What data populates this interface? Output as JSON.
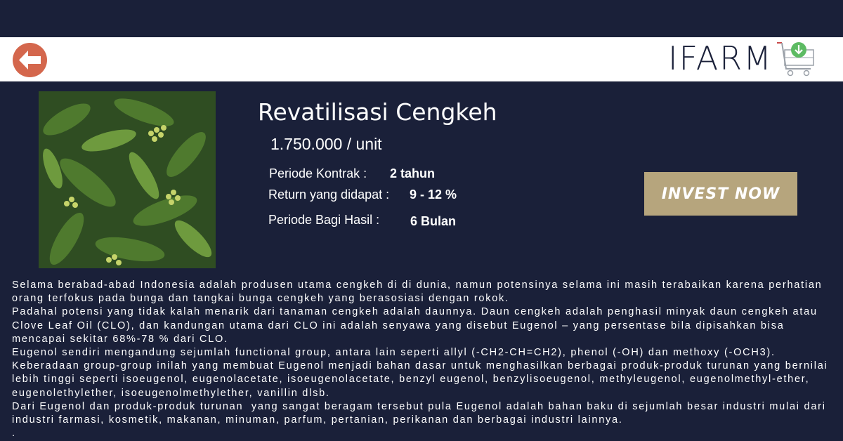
{
  "header": {
    "logo_text": "IFARM"
  },
  "product": {
    "title": "Revatilisasi Cengkeh",
    "price": "1.750.000 / unit",
    "details": [
      {
        "label": "Periode Kontrak :",
        "value": "2 tahun"
      },
      {
        "label": "Return yang didapat :",
        "value": "9 - 12 %"
      },
      {
        "label": "Periode Bagi Hasil :",
        "value": "6 Bulan"
      }
    ],
    "invest_label": "INVEST NOW"
  },
  "description": [
    "Selama berabad-abad Indonesia adalah produsen utama cengkeh di di dunia, namun potensinya selama ini masih terabaikan karena perhatian orang terfokus pada bunga dan tangkai bunga cengkeh yang berasosiasi dengan rokok.",
    "Padahal potensi yang tidak kalah menarik dari tanaman cengkeh adalah daunnya. Daun cengkeh adalah penghasil minyak daun cengkeh atau Clove Leaf Oil (CLO), dan kandungan utama dari CLO ini adalah senyawa yang disebut Eugenol – yang persentase bila dipisahkan bisa mencapai sekitar 68%-78 % dari CLO.",
    "Eugenol sendiri mengandung sejumlah functional group, antara lain seperti allyl (-CH2-CH=CH2), phenol (-OH) dan methoxy (-OCH3). Keberadaan group-group inilah yang membuat Eugenol menjadi bahan dasar untuk menghasilkan berbagai produk-produk turunan yang bernilai lebih tinggi seperti isoeugenol, eugenolacetate, isoeugenolacetate, benzyl eugenol, benzylisoeugenol, methyleugenol, eugenolmethyl-ether, eugenolethylether, isoeugenolmethylether, vanillin dlsb.",
    "Dari Eugenol dan produk-produk turunan  yang sangat beragam tersebut pula Eugenol adalah bahan baku di sejumlah besar industri mulai dari industri farmasi, kosmetik, makanan, minuman, parfum, pertanian, perikanan dan berbagai industri lainnya.",
    "."
  ],
  "icons": {
    "back": "back-arrow-icon",
    "cart": "cart-download-icon"
  },
  "colors": {
    "background": "#1a2039",
    "back_button": "#d4674d",
    "invest_button": "#b6a57d",
    "cart_badge": "#5dbb63"
  }
}
